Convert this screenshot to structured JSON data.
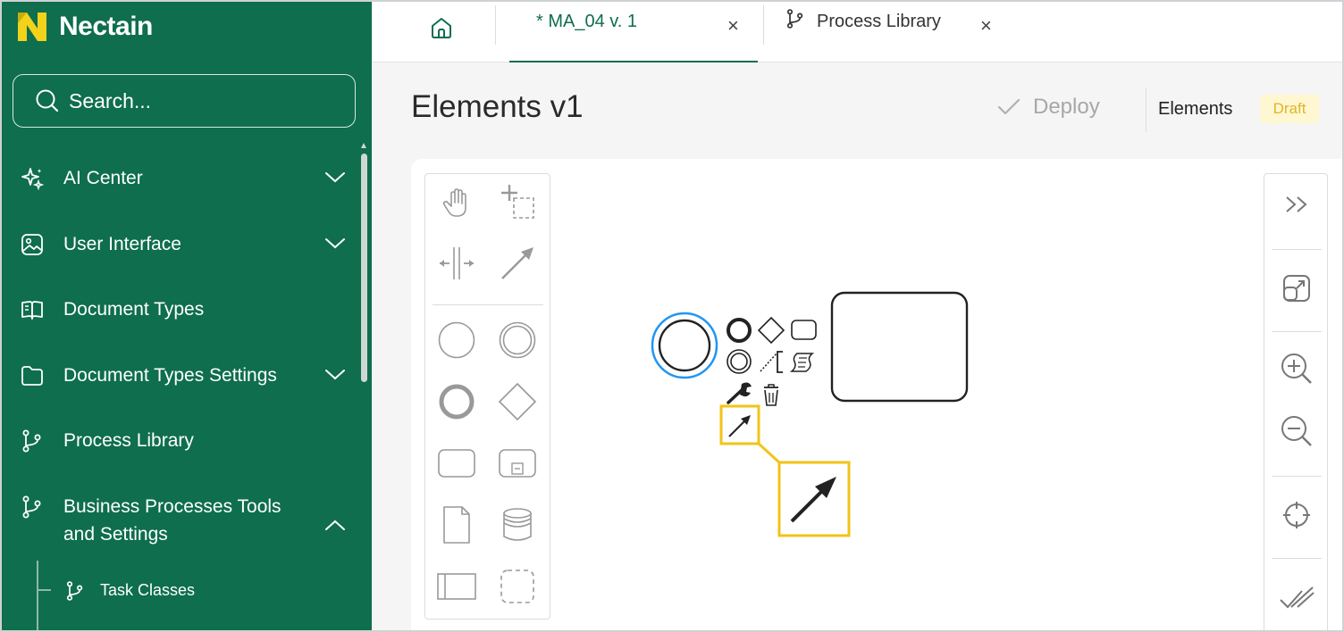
{
  "app": {
    "brand": "Nectain",
    "colors": {
      "brand_green": "#0e6e4d",
      "highlight": "#f2c318",
      "selection_blue": "#2196f3",
      "draft_bg": "#fff7d1",
      "draft_text": "#e0b528"
    }
  },
  "sidebar": {
    "search_placeholder": "Search...",
    "items": [
      {
        "label": "AI Center",
        "icon": "sparkles-icon",
        "chevron": "down"
      },
      {
        "label": "User Interface",
        "icon": "image-icon",
        "chevron": "down"
      },
      {
        "label": "Document Types",
        "icon": "book-icon",
        "chevron": ""
      },
      {
        "label": "Document Types Settings",
        "icon": "folder-icon",
        "chevron": "down"
      },
      {
        "label": "Process Library",
        "icon": "branch-icon",
        "chevron": ""
      },
      {
        "label": "Business Processes Tools",
        "label2": "and Settings",
        "icon": "branch-icon",
        "chevron": "up"
      }
    ],
    "subitems": [
      {
        "label": "Task Classes",
        "icon": "branch-icon"
      }
    ]
  },
  "tabs": [
    {
      "label": "* MA_04 v. 1",
      "active": true,
      "close": "×"
    },
    {
      "label": "Process Library",
      "active": false,
      "icon": "branch-icon",
      "close": "×"
    }
  ],
  "header": {
    "title": "Elements v1",
    "deploy_label": "Deploy",
    "elements_label": "Elements",
    "status_badge": "Draft"
  },
  "palette": {
    "tools": [
      "hand-tool-icon",
      "lasso-tool-icon",
      "space-tool-icon",
      "connect-tool-icon"
    ],
    "shapes": [
      "start-event-icon",
      "intermediate-event-icon",
      "end-event-icon",
      "gateway-icon",
      "task-icon",
      "subprocess-icon",
      "data-object-icon",
      "data-store-icon",
      "pool-icon",
      "group-icon"
    ]
  },
  "context_pad": [
    "end-event-icon",
    "gateway-icon",
    "task-icon",
    "intermediate-event-icon",
    "text-annotation-icon",
    "script-icon",
    "wrench-icon",
    "trash-icon",
    "connect-arrow-icon"
  ],
  "right_toolbar": [
    "collapse-panel-icon",
    "fit-view-icon",
    "zoom-in-icon",
    "zoom-out-icon",
    "reset-position-icon",
    "validate-icon"
  ]
}
